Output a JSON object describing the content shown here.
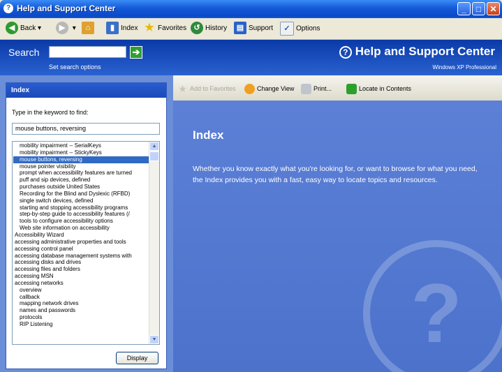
{
  "window": {
    "title": "Help and Support Center"
  },
  "toolbar": {
    "back": "Back",
    "index": "Index",
    "favorites": "Favorites",
    "history": "History",
    "support": "Support",
    "options": "Options"
  },
  "search": {
    "label": "Search",
    "value": "",
    "options_link": "Set search options"
  },
  "brand": {
    "title": "Help and Support Center",
    "subtitle": "Windows XP Professional"
  },
  "index_panel": {
    "header": "Index",
    "keyword_label": "Type in the keyword to find:",
    "keyword_value": "mouse buttons, reversing",
    "display_button": "Display",
    "items": [
      {
        "text": "mobility impairment -- SerialKeys",
        "indent": true
      },
      {
        "text": "mobility impairment -- StickyKeys",
        "indent": true
      },
      {
        "text": "mouse buttons, reversing",
        "indent": true,
        "selected": true
      },
      {
        "text": "mouse pointer visibility",
        "indent": true
      },
      {
        "text": "prompt when accessibility features are turned",
        "indent": true
      },
      {
        "text": "puff and sip devices, defined",
        "indent": true
      },
      {
        "text": "purchases outside United States",
        "indent": true
      },
      {
        "text": "Recording for the Blind and Dyslexic (RFBD)",
        "indent": true
      },
      {
        "text": "single switch devices, defined",
        "indent": true
      },
      {
        "text": "starting and stopping accessibility programs",
        "indent": true
      },
      {
        "text": "step-by-step guide to accessibility features (/",
        "indent": true
      },
      {
        "text": "tools to configure accessibility options",
        "indent": true
      },
      {
        "text": "Web site information on accessibility",
        "indent": true
      },
      {
        "text": "Accessibility Wizard",
        "indent": false
      },
      {
        "text": "accessing administrative properties and tools",
        "indent": false
      },
      {
        "text": "accessing control panel",
        "indent": false
      },
      {
        "text": "accessing database management systems with",
        "indent": false
      },
      {
        "text": "accessing disks and drives",
        "indent": false
      },
      {
        "text": "accessing files and folders",
        "indent": false
      },
      {
        "text": "accessing MSN",
        "indent": false
      },
      {
        "text": "accessing networks",
        "indent": false
      },
      {
        "text": "overview",
        "indent": true
      },
      {
        "text": "callback",
        "indent": true
      },
      {
        "text": "mapping network drives",
        "indent": true
      },
      {
        "text": "names and passwords",
        "indent": true
      },
      {
        "text": "protocols",
        "indent": true
      },
      {
        "text": "RIP Listening",
        "indent": true
      }
    ]
  },
  "commands": {
    "add_favorites": "Add to Favorites",
    "change_view": "Change View",
    "print": "Print...",
    "locate": "Locate in Contents"
  },
  "content": {
    "heading": "Index",
    "description": "Whether you know exactly what you're looking for, or want to browse for what you need, the Index provides you with a fast, easy way to locate topics and resources."
  },
  "colors": {
    "accent": "#316ac5",
    "content_bg": "#5c80d6",
    "title_bar": "#1559d8"
  }
}
